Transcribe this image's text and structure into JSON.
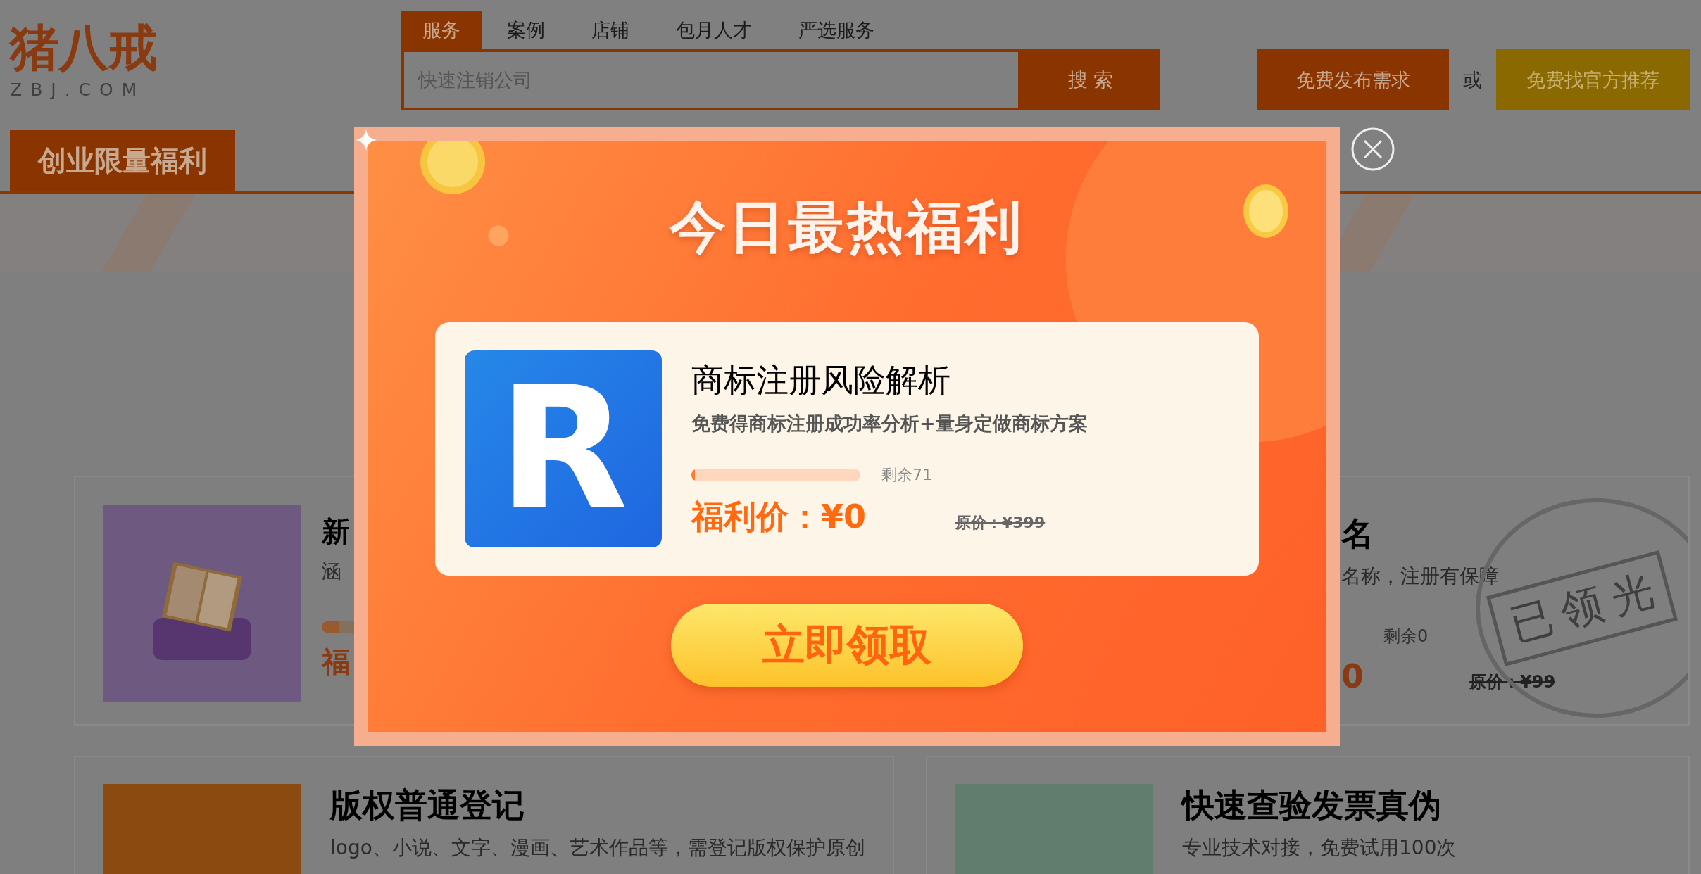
{
  "header": {
    "logo": {
      "name": "猪八戒",
      "domain": "ZBJ.COM"
    },
    "search_tabs": [
      {
        "label": "服务",
        "selected": true
      },
      {
        "label": "案例",
        "selected": false
      },
      {
        "label": "店铺",
        "selected": false
      },
      {
        "label": "包月人才",
        "selected": false
      },
      {
        "label": "严选服务",
        "selected": false
      }
    ],
    "search": {
      "placeholder": "快速注销公司",
      "button": "搜 索"
    },
    "post_button": "免费发布需求",
    "or": "或",
    "recommend_button": "免费找官方推荐"
  },
  "section": {
    "tab": "创业限量福利"
  },
  "cards": [
    {
      "kind": "book",
      "title": "新",
      "subtitle": "涵",
      "level": 0.1,
      "price": "福"
    },
    {
      "kind": "covered",
      "title": "名",
      "subtitle": "名称，注册有保障",
      "remaining": "剩余0",
      "price": "0",
      "original_price": "原价：¥99",
      "stamp": "已领光"
    },
    {
      "kind": "ticket",
      "title": "版权普通登记",
      "subtitle": "logo、小说、文字、漫画、艺术作品等，需登记版权保护原创"
    },
    {
      "kind": "invoice",
      "title": "快速查验发票真伪",
      "subtitle": "专业技术对接，免费试用100次"
    }
  ],
  "popup": {
    "title": "今日最热福利",
    "offer": {
      "icon_letter": "R",
      "title": "商标注册风险解析",
      "subtitle": "免费得商标注册成功率分析+量身定做商标方案",
      "level": 0.02,
      "remaining": "剩余71",
      "price": "福利价：¥0",
      "original_price": "原价：¥399"
    },
    "button": "立即领取"
  }
}
